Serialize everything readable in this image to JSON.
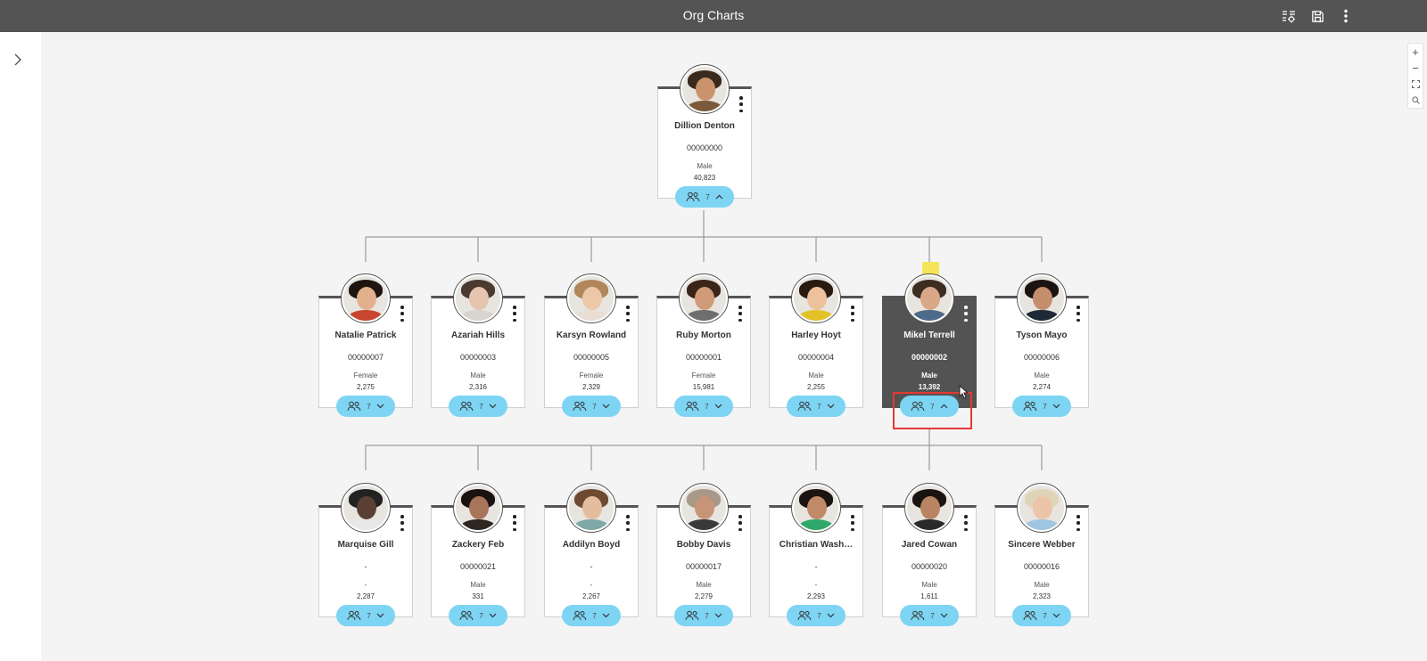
{
  "app": {
    "title": "Org Charts",
    "toolbar": [
      {
        "icon": "settings-list-icon"
      },
      {
        "icon": "save-icon"
      },
      {
        "icon": "more-vertical-icon"
      }
    ]
  },
  "sidebar": {
    "toggle_icon": "chevron-right-icon"
  },
  "zoom_controls": {
    "zoom_in": "+",
    "zoom_out": "−",
    "fit_icon": "fit-screen-icon",
    "search_icon": "search-icon"
  },
  "colors": {
    "accent": "#7dd4f3",
    "topbar": "#545454",
    "selected_node": "#535353",
    "highlight": "#e53935",
    "marker": "#f5e55b"
  },
  "nodes": [
    {
      "id": "dillion",
      "name": "Dillion Denton",
      "emp_id": "00000000",
      "gender": "Male",
      "value": "40,823",
      "count": "7",
      "expanded": true,
      "selected": false,
      "hair": "#3a2a1e",
      "skin": "#c9946b",
      "shirt": "#7a5a3a"
    },
    {
      "id": "natalie",
      "name": "Natalie Patrick",
      "emp_id": "00000007",
      "gender": "Female",
      "value": "2,275",
      "count": "7",
      "expanded": false,
      "selected": false,
      "hair": "#1e1410",
      "skin": "#e2b08c",
      "shirt": "#c8462e"
    },
    {
      "id": "azariah",
      "name": "Azariah Hills",
      "emp_id": "00000003",
      "gender": "Male",
      "value": "2,316",
      "count": "7",
      "expanded": false,
      "selected": false,
      "hair": "#4a3a30",
      "skin": "#e6c4ae",
      "shirt": "#d9d4cf"
    },
    {
      "id": "karsyn",
      "name": "Karsyn Rowland",
      "emp_id": "00000005",
      "gender": "Female",
      "value": "2,329",
      "count": "7",
      "expanded": false,
      "selected": false,
      "hair": "#b0875a",
      "skin": "#ecc7a8",
      "shirt": "#e8ded4"
    },
    {
      "id": "ruby",
      "name": "Ruby Morton",
      "emp_id": "00000001",
      "gender": "Female",
      "value": "15,981",
      "count": "7",
      "expanded": false,
      "selected": false,
      "hair": "#3b2418",
      "skin": "#d19a78",
      "shirt": "#6e6e6e"
    },
    {
      "id": "harley",
      "name": "Harley Hoyt",
      "emp_id": "00000004",
      "gender": "Male",
      "value": "2,255",
      "count": "7",
      "expanded": false,
      "selected": false,
      "hair": "#2a1b12",
      "skin": "#ecc19b",
      "shirt": "#e2c227"
    },
    {
      "id": "mikel",
      "name": "Mikel Terrell",
      "emp_id": "00000002",
      "gender": "Male",
      "value": "13,392",
      "count": "7",
      "expanded": true,
      "selected": true,
      "hair": "#3c2c22",
      "skin": "#d8a888",
      "shirt": "#4d6b88"
    },
    {
      "id": "tyson",
      "name": "Tyson Mayo",
      "emp_id": "00000006",
      "gender": "Male",
      "value": "2,274",
      "count": "7",
      "expanded": false,
      "selected": false,
      "hair": "#1b1410",
      "skin": "#c48e6c",
      "shirt": "#1e2a38"
    },
    {
      "id": "marquise",
      "name": "Marquise Gill",
      "emp_id": "-",
      "gender": "-",
      "value": "2,287",
      "count": "7",
      "expanded": false,
      "selected": false,
      "hair": "#222222",
      "skin": "#5a4034",
      "shirt": "#e8e8e8"
    },
    {
      "id": "zackery",
      "name": "Zackery Feb",
      "emp_id": "00000021",
      "gender": "Male",
      "value": "331",
      "count": "7",
      "expanded": false,
      "selected": false,
      "hair": "#1a1210",
      "skin": "#a8745a",
      "shirt": "#2e2620"
    },
    {
      "id": "addilyn",
      "name": "Addilyn Boyd",
      "emp_id": "-",
      "gender": "-",
      "value": "2,267",
      "count": "7",
      "expanded": false,
      "selected": false,
      "hair": "#6e4a32",
      "skin": "#e4bc9e",
      "shirt": "#7fa8a8"
    },
    {
      "id": "bobby",
      "name": "Bobby Davis",
      "emp_id": "00000017",
      "gender": "Male",
      "value": "2,279",
      "count": "7",
      "expanded": false,
      "selected": false,
      "hair": "#a89888",
      "skin": "#c89478",
      "shirt": "#3a3a3a"
    },
    {
      "id": "christian",
      "name": "Christian Wash…",
      "emp_id": "-",
      "gender": "-",
      "value": "2,293",
      "count": "7",
      "expanded": false,
      "selected": false,
      "hair": "#1c1410",
      "skin": "#c08a68",
      "shirt": "#2fa86a"
    },
    {
      "id": "jared",
      "name": "Jared Cowan",
      "emp_id": "00000020",
      "gender": "Male",
      "value": "1,611",
      "count": "7",
      "expanded": false,
      "selected": false,
      "hair": "#1a1410",
      "skin": "#b88462",
      "shirt": "#2a2a2a"
    },
    {
      "id": "sincere",
      "name": "Sincere Webber",
      "emp_id": "00000016",
      "gender": "Male",
      "value": "2,323",
      "count": "7",
      "expanded": false,
      "selected": false,
      "hair": "#e0d4b8",
      "skin": "#ecc4a8",
      "shirt": "#9fc6e0"
    }
  ]
}
